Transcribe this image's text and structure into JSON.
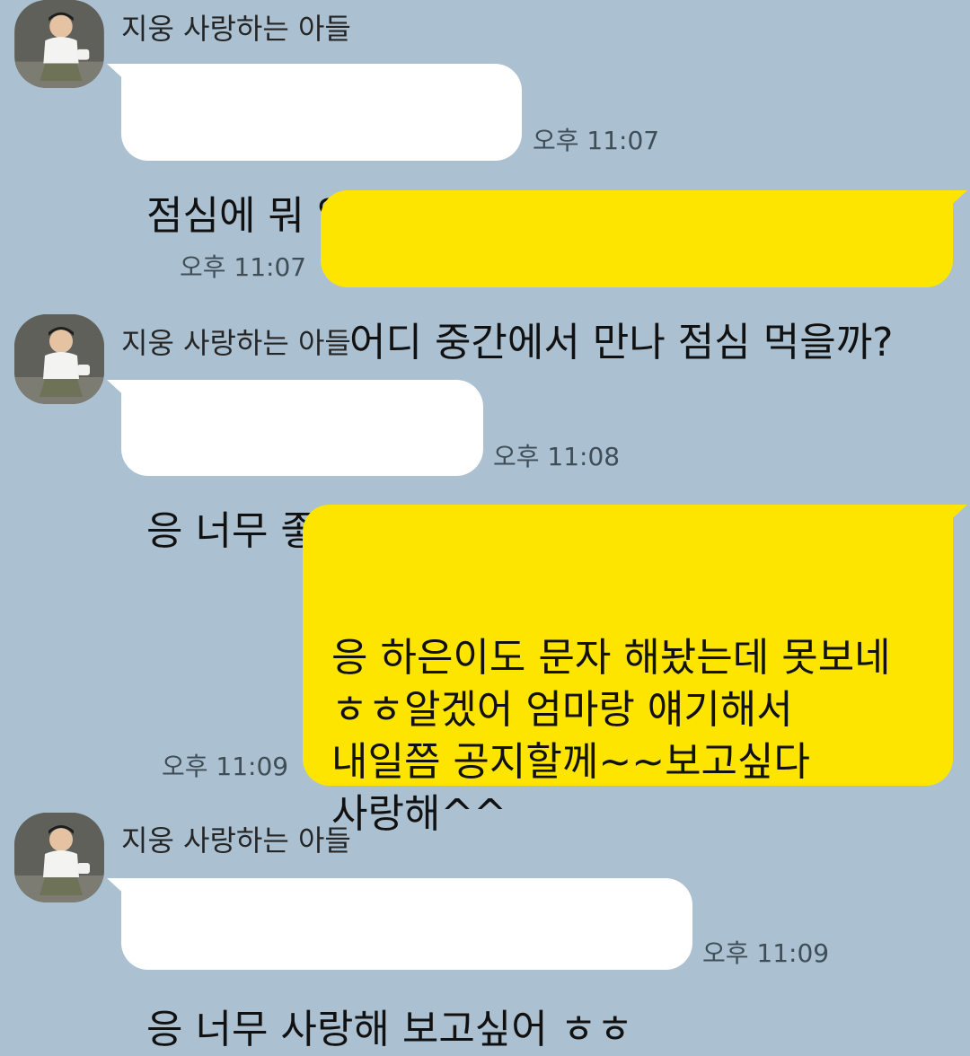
{
  "colors": {
    "background": "#abc1d1",
    "incoming_bubble": "#ffffff",
    "outgoing_bubble": "#fee500",
    "timestamp": "#3f4d57"
  },
  "messages": [
    {
      "direction": "incoming",
      "sender": "지웅 사랑하는 아들",
      "text": "점심에 뭐 없어 ㅎㅎ",
      "time": "오후 11:07"
    },
    {
      "direction": "outgoing",
      "text": "어디 중간에서 만나 점심 먹을까?",
      "time": "오후 11:07"
    },
    {
      "direction": "incoming",
      "sender": "지웅 사랑하는 아들",
      "text": "응 너무 좋아 ㅎㅎ",
      "time": "오후 11:08"
    },
    {
      "direction": "outgoing",
      "text": "응 하은이도 문자 해놨는데 못보네\nㅎㅎ알겠어 엄마랑 얘기해서\n내일쯤 공지할께~~보고싶다\n사랑해^^",
      "time": "오후 11:09"
    },
    {
      "direction": "incoming",
      "sender": "지웅 사랑하는 아들",
      "text": "응 너무 사랑해 보고싶어 ㅎㅎ",
      "time": "오후 11:09"
    }
  ]
}
